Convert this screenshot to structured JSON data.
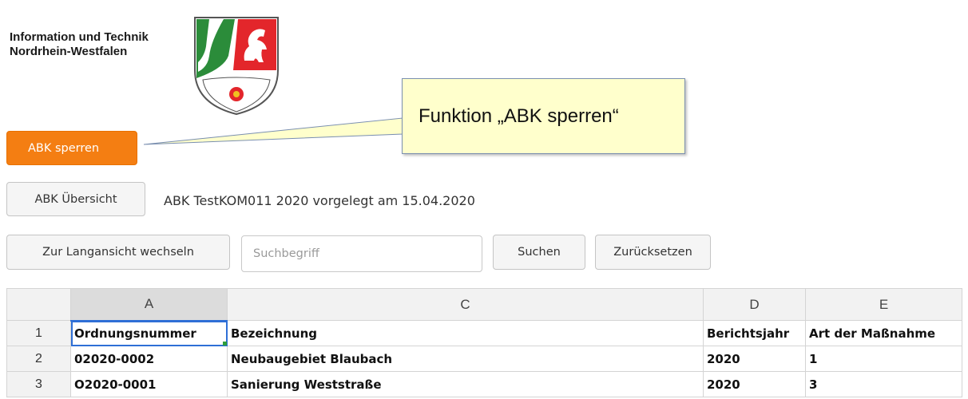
{
  "header": {
    "org_line1": "Information und Technik",
    "org_line2": "Nordrhein-Westfalen",
    "logo_icon": "nrw-coat-of-arms-icon"
  },
  "colors": {
    "accent": "#f47e12",
    "selection": "#2f6fd6",
    "callout_bg": "#ffffcc",
    "logo_green": "#2b8c3a",
    "logo_red": "#e3262b"
  },
  "actions": {
    "lock_button": "ABK sperren"
  },
  "callout": {
    "text": "Funktion „ABK sperren“"
  },
  "overview": {
    "button": "ABK Übersicht",
    "status": "ABK TestKOM011 2020 vorgelegt am 15.04.2020"
  },
  "toolbar": {
    "long_view_button": "Zur Langansicht wechseln",
    "search_placeholder": "Suchbegriff",
    "search_button": "Suchen",
    "reset_button": "Zurücksetzen"
  },
  "sheet": {
    "columns": [
      "A",
      "C",
      "D",
      "E"
    ],
    "rows": [
      {
        "num": "1",
        "cells": [
          "Ordnungsnummer",
          "Bezeichnung",
          "Berichtsjahr",
          "Art der Maßnahme"
        ]
      },
      {
        "num": "2",
        "cells": [
          "02020-0002",
          "Neubaugebiet Blaubach",
          "2020",
          "1"
        ]
      },
      {
        "num": "3",
        "cells": [
          "O2020-0001",
          "Sanierung Weststraße",
          "2020",
          "3"
        ]
      }
    ]
  }
}
